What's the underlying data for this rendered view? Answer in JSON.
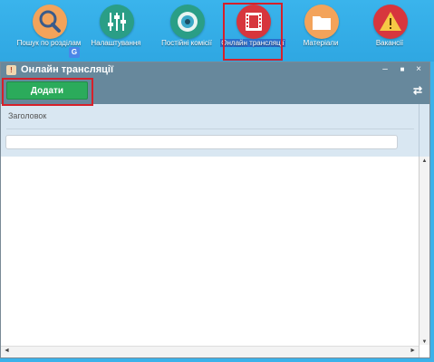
{
  "desktop": {
    "icons": [
      {
        "label": "Пошук по розділам",
        "color": "#f3a35a",
        "glyph": "search-icon"
      },
      {
        "label": "Налаштування",
        "color": "#2a9e86",
        "glyph": "sliders-icon"
      },
      {
        "label": "Постійні комісії",
        "color": "#2a9e86",
        "glyph": "eye-icon"
      },
      {
        "label": "Онлайн трансляції",
        "color": "#d7363d",
        "glyph": "film-icon"
      },
      {
        "label": "Матеріали",
        "color": "#f3a35a",
        "glyph": "folder-icon"
      },
      {
        "label": "Вакансії",
        "color": "#d7363d",
        "glyph": "warning-icon"
      }
    ]
  },
  "window": {
    "title": "Онлайн трансляції",
    "buttons": {
      "minimize": "–",
      "maximize": "■",
      "close": "×"
    }
  },
  "toolbar": {
    "add_label": "Додати",
    "refresh_glyph": "⇄"
  },
  "filter": {
    "column_label": "Заголовок",
    "value": "",
    "placeholder": ""
  },
  "scroll": {
    "up": "▲",
    "down": "▼",
    "left": "◄",
    "right": "►"
  }
}
